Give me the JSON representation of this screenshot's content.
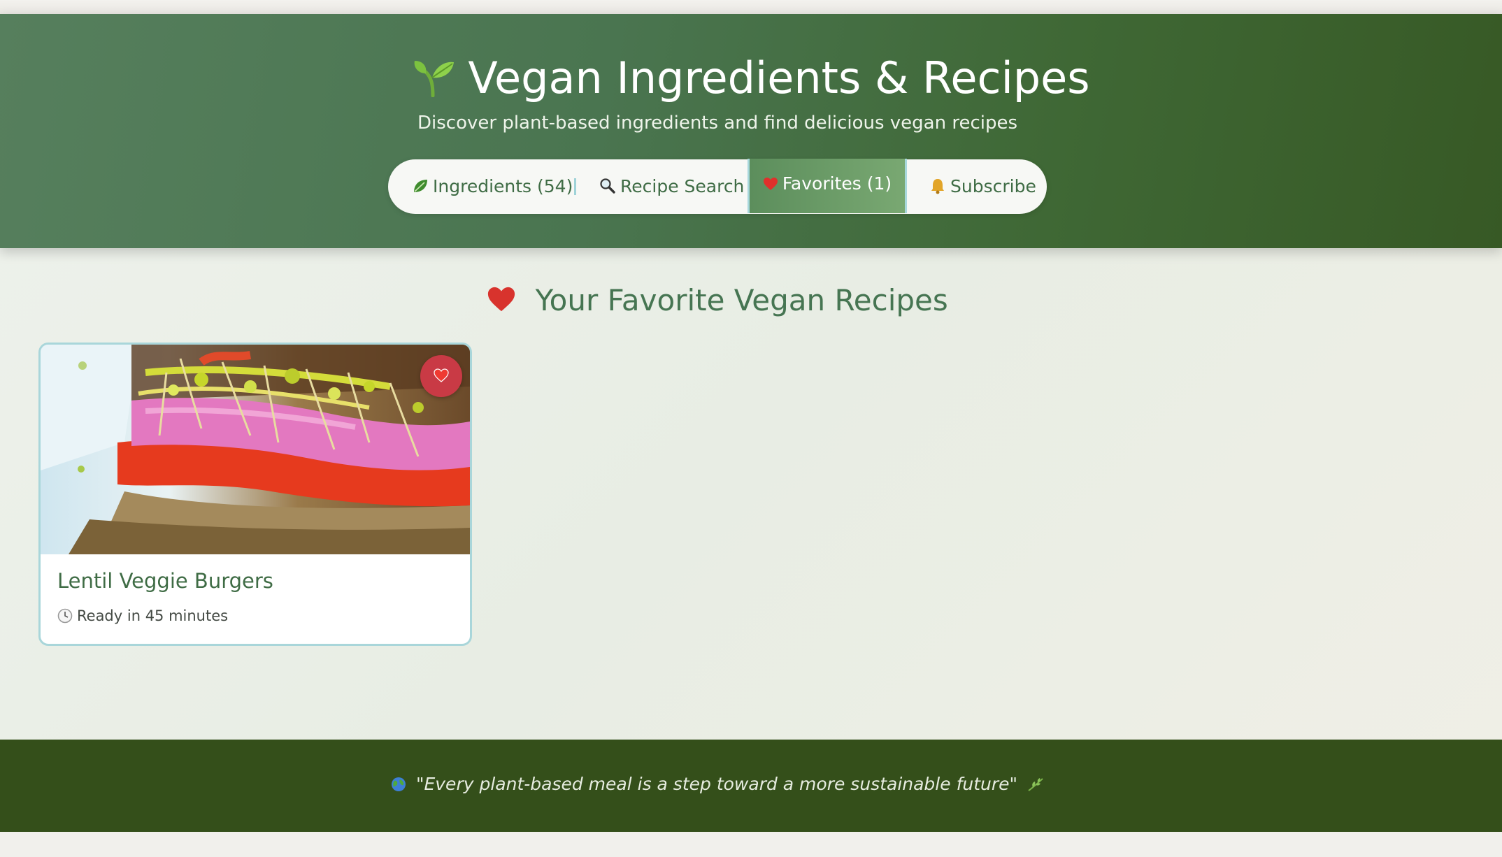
{
  "header": {
    "icon": "sprout-icon",
    "title": "Vegan Ingredients & Recipes",
    "subtitle": "Discover plant-based ingredients and find delicious vegan recipes"
  },
  "nav": {
    "items": [
      {
        "icon": "leaf-icon",
        "label": "Ingredients (54)"
      },
      {
        "icon": "magnifier-icon",
        "label": "Recipe Search"
      },
      {
        "icon": "heart-icon",
        "label": "Favorites (1)",
        "active": true
      },
      {
        "icon": "bell-icon",
        "label": "Subscribe"
      }
    ]
  },
  "favorites": {
    "title": "Your Favorite Vegan Recipes",
    "recipes": [
      {
        "title": "Lentil Veggie Burgers",
        "meta": "Ready in 45 minutes",
        "favorited": true
      }
    ]
  },
  "footer": {
    "quote": "\"Every plant-based meal is a step toward a more sustainable future\""
  },
  "colors": {
    "header_green": "#4a7550",
    "accent_green": "#3f6c45",
    "footer_green": "#344f1a",
    "heart_red": "#c93a45",
    "card_border": "#a9d6da"
  }
}
